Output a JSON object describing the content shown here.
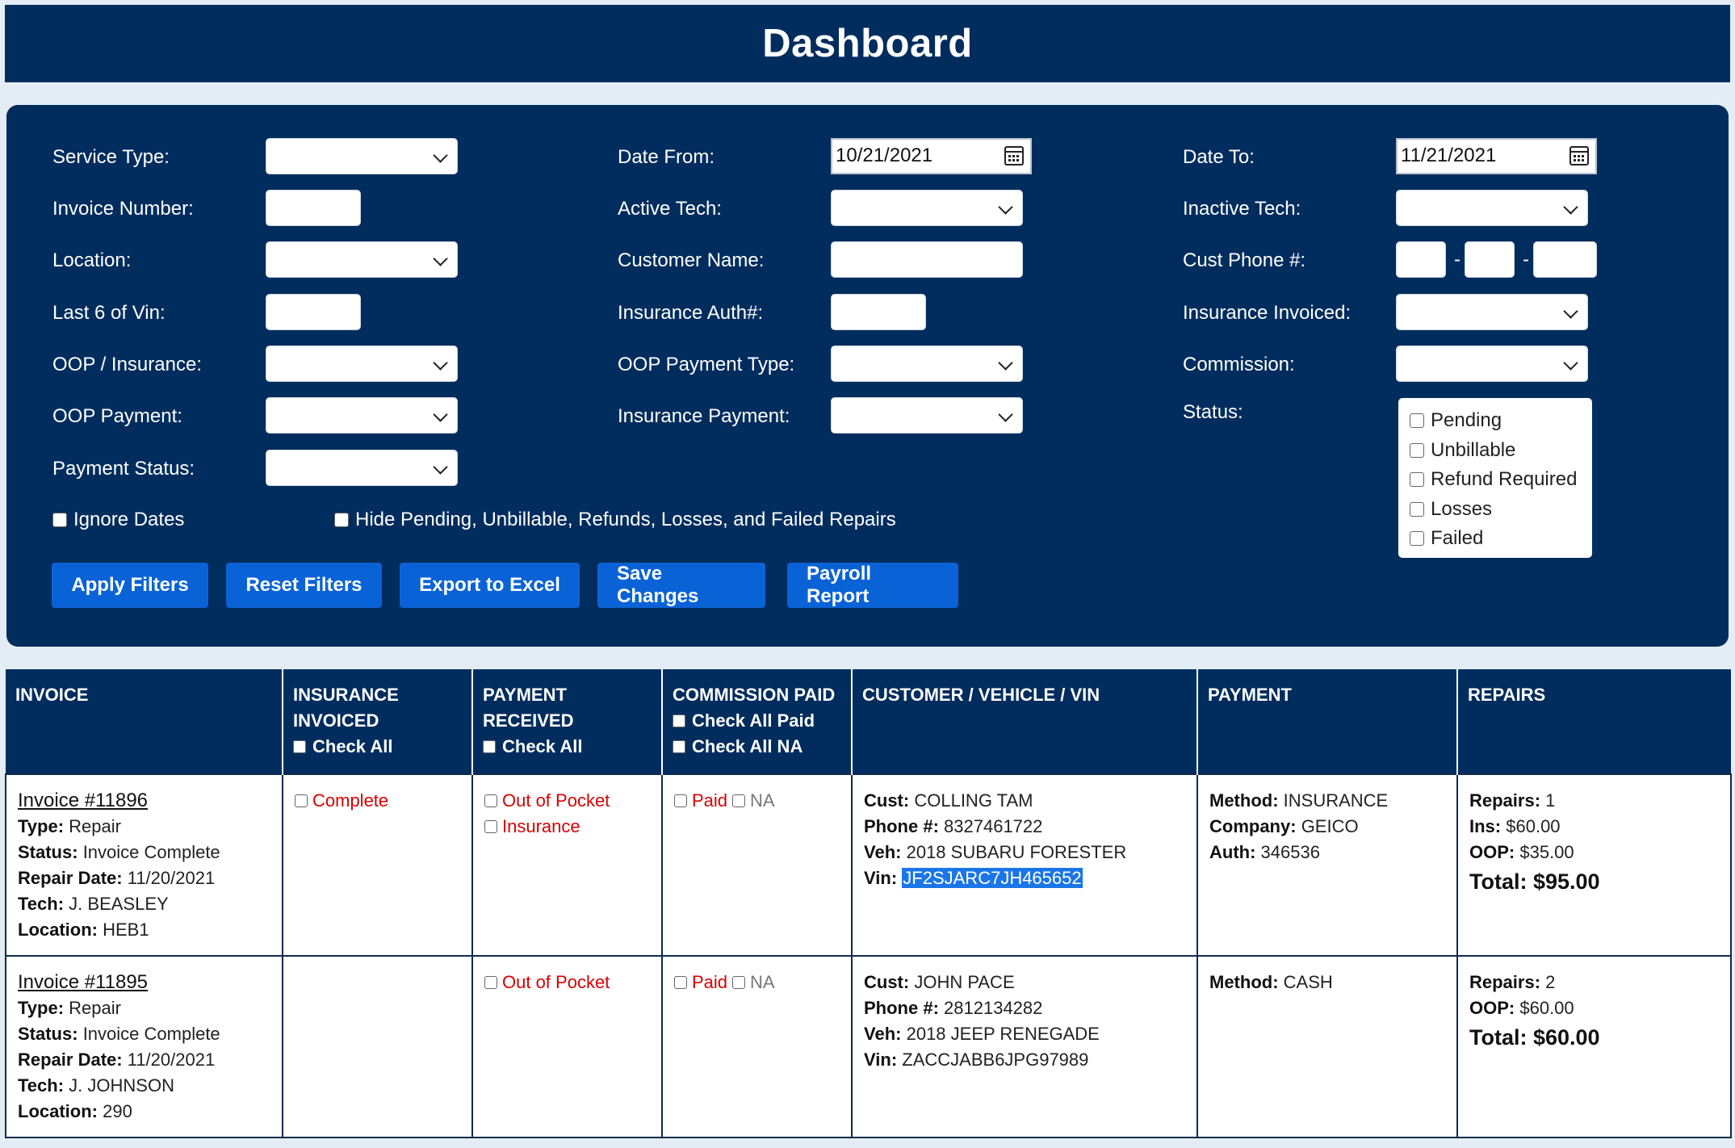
{
  "header": {
    "title": "Dashboard"
  },
  "filters": {
    "service_type_label": "Service Type:",
    "invoice_number_label": "Invoice Number:",
    "location_label": "Location:",
    "last6vin_label": "Last 6 of Vin:",
    "oop_insurance_label": "OOP / Insurance:",
    "oop_payment_label": "OOP Payment:",
    "payment_status_label": "Payment Status:",
    "date_from_label": "Date From:",
    "date_from_value": "10/21/2021",
    "active_tech_label": "Active Tech:",
    "customer_name_label": "Customer Name:",
    "insurance_auth_label": "Insurance Auth#:",
    "oop_payment_type_label": "OOP Payment Type:",
    "insurance_payment_label": "Insurance Payment:",
    "date_to_label": "Date To:",
    "date_to_value": "11/21/2021",
    "inactive_tech_label": "Inactive Tech:",
    "cust_phone_label": "Cust Phone #:",
    "phone_sep": "-",
    "insurance_invoiced_label": "Insurance Invoiced:",
    "commission_label": "Commission:",
    "status_label": "Status:",
    "status_options": [
      "Pending",
      "Unbillable",
      "Refund Required",
      "Losses",
      "Failed"
    ],
    "ignore_dates_label": "Ignore Dates",
    "hide_pending_label": "Hide Pending, Unbillable, Refunds, Losses, and Failed Repairs"
  },
  "buttons": {
    "apply": "Apply Filters",
    "reset": "Reset Filters",
    "export": "Export to Excel",
    "save": "Save Changes",
    "payroll": "Payroll Report"
  },
  "table": {
    "headers": {
      "invoice": "INVOICE",
      "insurance_invoiced_1": "INSURANCE",
      "insurance_invoiced_2": "INVOICED",
      "payment_received_1": "PAYMENT",
      "payment_received_2": "RECEIVED",
      "check_all": "Check All",
      "commission_paid": "COMMISSION PAID",
      "check_all_paid": "Check All Paid",
      "check_all_na": "Check All NA",
      "customer": "CUSTOMER / VEHICLE / VIN",
      "payment": "PAYMENT",
      "repairs": "REPAIRS"
    },
    "labels": {
      "type": "Type:",
      "status": "Status:",
      "repair_date": "Repair Date:",
      "tech": "Tech:",
      "location": "Location:",
      "cust": "Cust:",
      "phone": "Phone #:",
      "veh": "Veh:",
      "vin": "Vin:",
      "method": "Method:",
      "company": "Company:",
      "auth": "Auth:",
      "repairs": "Repairs:",
      "ins": "Ins:",
      "oop": "OOP:",
      "complete": "Complete",
      "out_of_pocket": "Out of Pocket",
      "insurance": "Insurance",
      "paid": "Paid",
      "na": "NA"
    },
    "rows": [
      {
        "invoice": "Invoice #11896",
        "type": "Repair",
        "status": "Invoice Complete",
        "repair_date": "11/20/2021",
        "tech": "J. BEASLEY",
        "location": "HEB1",
        "cust": "COLLING TAM",
        "phone": "8327461722",
        "veh": "2018 SUBARU FORESTER",
        "vin": "JF2SJARC7JH465652",
        "method": "INSURANCE",
        "company": "GEICO",
        "auth": "346536",
        "repairs": "1",
        "ins": "$60.00",
        "oop": "$35.00",
        "total": "Total: $95.00"
      },
      {
        "invoice": "Invoice #11895",
        "type": "Repair",
        "status": "Invoice Complete",
        "repair_date": "11/20/2021",
        "tech": "J. JOHNSON",
        "location": "290",
        "cust": "JOHN PACE",
        "phone": "2812134282",
        "veh": "2018 JEEP RENEGADE",
        "vin": "ZACCJABB6JPG97989",
        "method": "CASH",
        "repairs": "2",
        "oop": "$60.00",
        "total": "Total: $60.00"
      }
    ]
  }
}
